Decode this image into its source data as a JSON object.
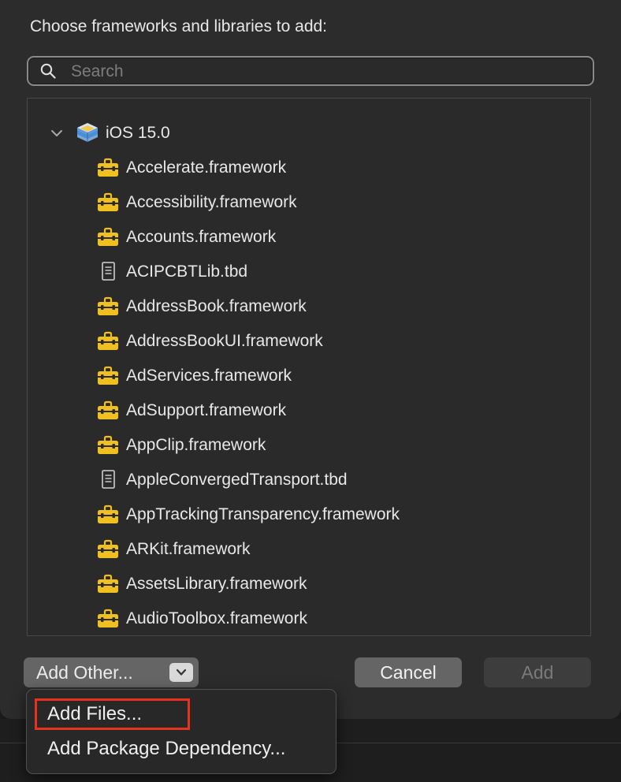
{
  "dialog": {
    "title": "Choose frameworks and libraries to add:",
    "search": {
      "placeholder": "Search",
      "value": ""
    },
    "group": {
      "label": "iOS 15.0",
      "expanded": true,
      "icon": "sdk-stack-icon"
    },
    "items": [
      {
        "label": "Accelerate.framework",
        "icon": "framework-toolbox-icon"
      },
      {
        "label": "Accessibility.framework",
        "icon": "framework-toolbox-icon"
      },
      {
        "label": "Accounts.framework",
        "icon": "framework-toolbox-icon"
      },
      {
        "label": "ACIPCBTLib.tbd",
        "icon": "text-document-icon"
      },
      {
        "label": "AddressBook.framework",
        "icon": "framework-toolbox-icon"
      },
      {
        "label": "AddressBookUI.framework",
        "icon": "framework-toolbox-icon"
      },
      {
        "label": "AdServices.framework",
        "icon": "framework-toolbox-icon"
      },
      {
        "label": "AdSupport.framework",
        "icon": "framework-toolbox-icon"
      },
      {
        "label": "AppClip.framework",
        "icon": "framework-toolbox-icon"
      },
      {
        "label": "AppleConvergedTransport.tbd",
        "icon": "text-document-icon"
      },
      {
        "label": "AppTrackingTransparency.framework",
        "icon": "framework-toolbox-icon"
      },
      {
        "label": "ARKit.framework",
        "icon": "framework-toolbox-icon"
      },
      {
        "label": "AssetsLibrary.framework",
        "icon": "framework-toolbox-icon"
      },
      {
        "label": "AudioToolbox.framework",
        "icon": "framework-toolbox-icon"
      }
    ],
    "buttons": {
      "add_other": "Add Other...",
      "cancel": "Cancel",
      "add": "Add"
    },
    "menu": {
      "items": [
        {
          "label": "Add Files...",
          "highlighted": true
        },
        {
          "label": "Add Package Dependency..."
        }
      ]
    }
  },
  "colors": {
    "framework_icon": "#f0c020",
    "highlight_border": "#e8321c",
    "sheet_bg": "#2c2c2d"
  }
}
